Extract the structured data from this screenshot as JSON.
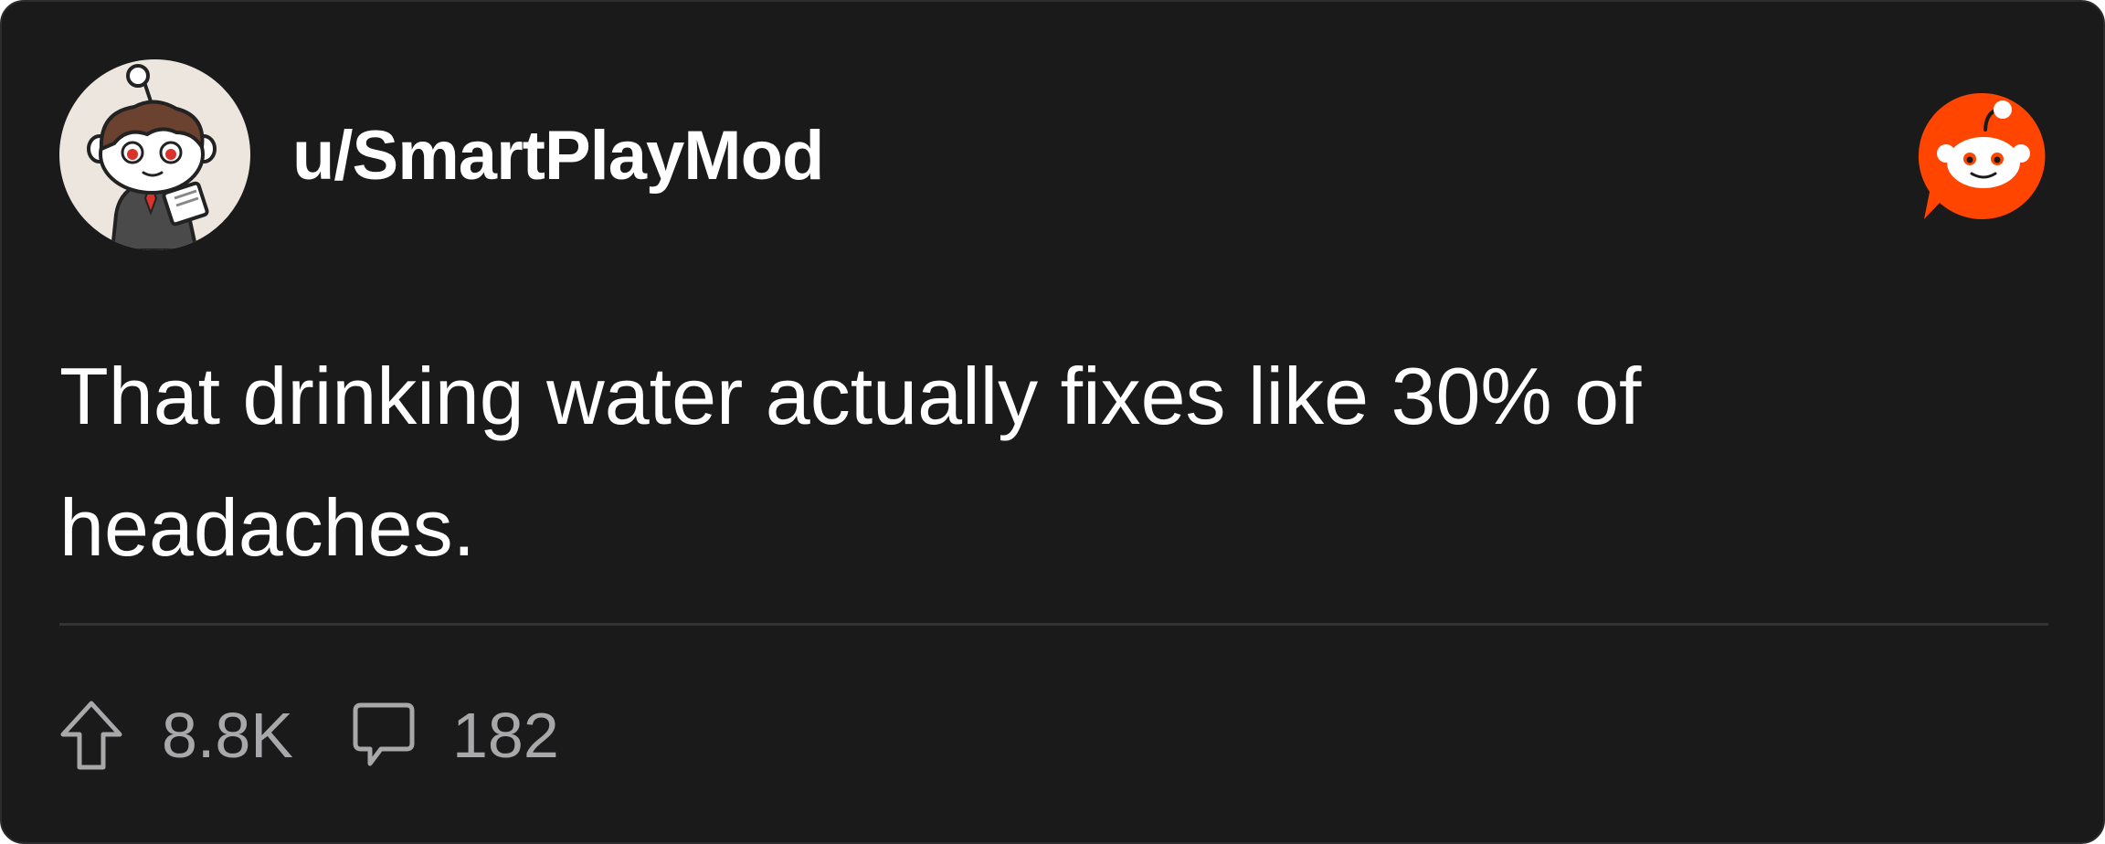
{
  "post": {
    "username": "u/SmartPlayMod",
    "avatar_icon": "snoo-avatar-icon",
    "brand_icon": "reddit-logo-icon",
    "text": "That drinking water actually fixes like 30% of headaches.",
    "upvote_icon": "upvote-arrow-icon",
    "upvote_count": "8.8K",
    "comment_icon": "comment-bubble-icon",
    "comment_count": "182"
  },
  "colors": {
    "card_background": "#1a1a1b",
    "text_primary": "#ffffff",
    "text_secondary": "#a8a8aa",
    "brand_orange": "#ff4500"
  }
}
